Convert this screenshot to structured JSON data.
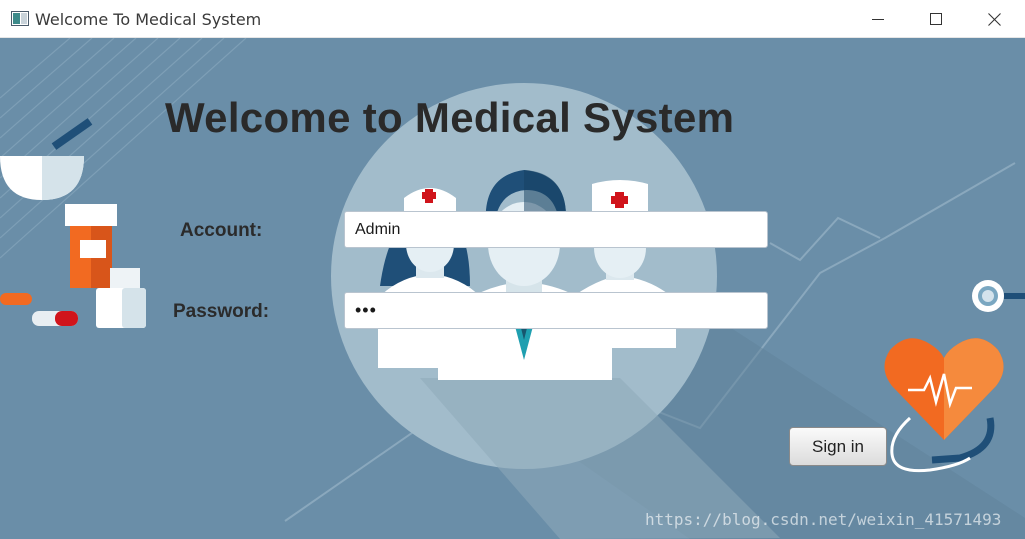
{
  "window": {
    "title": "Welcome To Medical System",
    "icons": {
      "app": "window-app-icon",
      "minimize": "minimize-icon",
      "maximize": "maximize-icon",
      "close": "close-icon"
    }
  },
  "login": {
    "heading": "Welcome to Medical System",
    "account_label": "Account:",
    "account_value": "Admin",
    "password_label": "Password:",
    "password_value": "•••",
    "signin_label": "Sign in"
  },
  "watermark": "https://blog.csdn.net/weixin_41571493",
  "colors": {
    "background": "#6a8ea8",
    "circle": "#a2bccb",
    "heart": "#f26a21",
    "accent_dark": "#1f4f78"
  }
}
